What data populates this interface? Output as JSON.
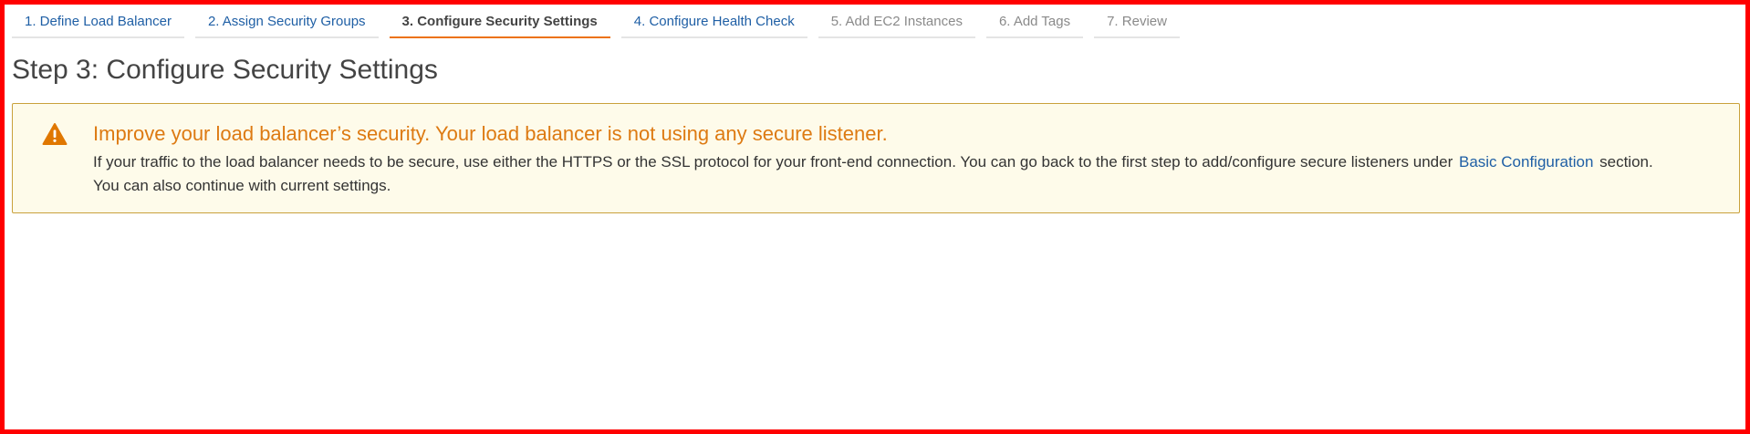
{
  "wizard": {
    "steps": [
      {
        "label": "1. Define Load Balancer"
      },
      {
        "label": "2. Assign Security Groups"
      },
      {
        "label": "3. Configure Security Settings"
      },
      {
        "label": "4. Configure Health Check"
      },
      {
        "label": "5. Add EC2 Instances"
      },
      {
        "label": "6. Add Tags"
      },
      {
        "label": "7. Review"
      }
    ],
    "active_step": 3
  },
  "page": {
    "title": "Step 3: Configure Security Settings"
  },
  "alert": {
    "icon": "warning-icon",
    "title": "Improve your load balancer’s security. Your load balancer is not using any secure listener.",
    "line1_before_link": "If your traffic to the load balancer needs to be secure, use either the HTTPS or the SSL protocol for your front-end connection. You can go back to the first step to add/configure secure listeners under ",
    "link_text": "Basic Configuration",
    "line1_after_link": " section.",
    "line2": "You can also continue with current settings."
  },
  "colors": {
    "frame_border": "#ff0000",
    "link_blue": "#1f5fa5",
    "active_tab_underline": "#ec7211",
    "alert_background": "#fefbea",
    "alert_border": "#c9a13c",
    "alert_title": "#dd7a12"
  }
}
